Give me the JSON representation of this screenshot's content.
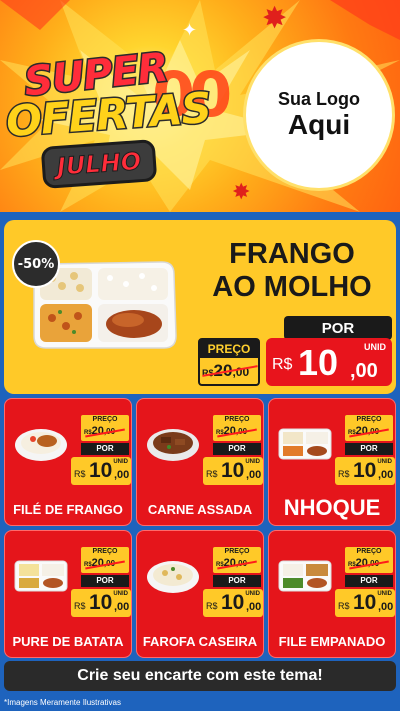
{
  "header": {
    "title_line1": "SUPER",
    "title_line2": "OFERTAS",
    "month_badge": "JULHO",
    "logo_line1": "Sua Logo",
    "logo_line2": "Aqui"
  },
  "featured": {
    "discount": "-50%",
    "name_line1": "FRANGO",
    "name_line2": "AO MOLHO",
    "preco_label": "PREÇO",
    "old_currency": "R$",
    "old_int": "20",
    "old_cents": ",00",
    "por_label": "POR",
    "currency": "R$",
    "price_int": "10",
    "price_cents": ",00",
    "unit": "UNID"
  },
  "product_labels": {
    "preco": "PREÇO",
    "por": "POR",
    "currency": "R$",
    "unit": "UNID"
  },
  "products": [
    {
      "name": "FILÉ DE FRANGO",
      "old_int": "20",
      "old_cents": ",00",
      "price_int": "10",
      "price_cents": ",00"
    },
    {
      "name": "CARNE ASSADA",
      "old_int": "20",
      "old_cents": ",00",
      "price_int": "10",
      "price_cents": ",00"
    },
    {
      "name": "NHOQUE",
      "old_int": "20",
      "old_cents": ",00",
      "price_int": "10",
      "price_cents": ",00"
    },
    {
      "name": "PURE DE BATATA",
      "old_int": "20",
      "old_cents": ",00",
      "price_int": "10",
      "price_cents": ",00"
    },
    {
      "name": "FAROFA CASEIRA",
      "old_int": "20",
      "old_cents": ",00",
      "price_int": "10",
      "price_cents": ",00"
    },
    {
      "name": "FILE EMPANADO",
      "old_int": "20",
      "old_cents": ",00",
      "price_int": "10",
      "price_cents": ",00"
    }
  ],
  "cta": "Crie seu encarte com este tema!",
  "disclaimer": "*Imagens Meramente Ilustrativas",
  "colors": {
    "card_red": "#e5151b",
    "accent_yellow": "#ffc928",
    "background_blue": "#1e63bd",
    "dark": "#1a1a1a"
  }
}
